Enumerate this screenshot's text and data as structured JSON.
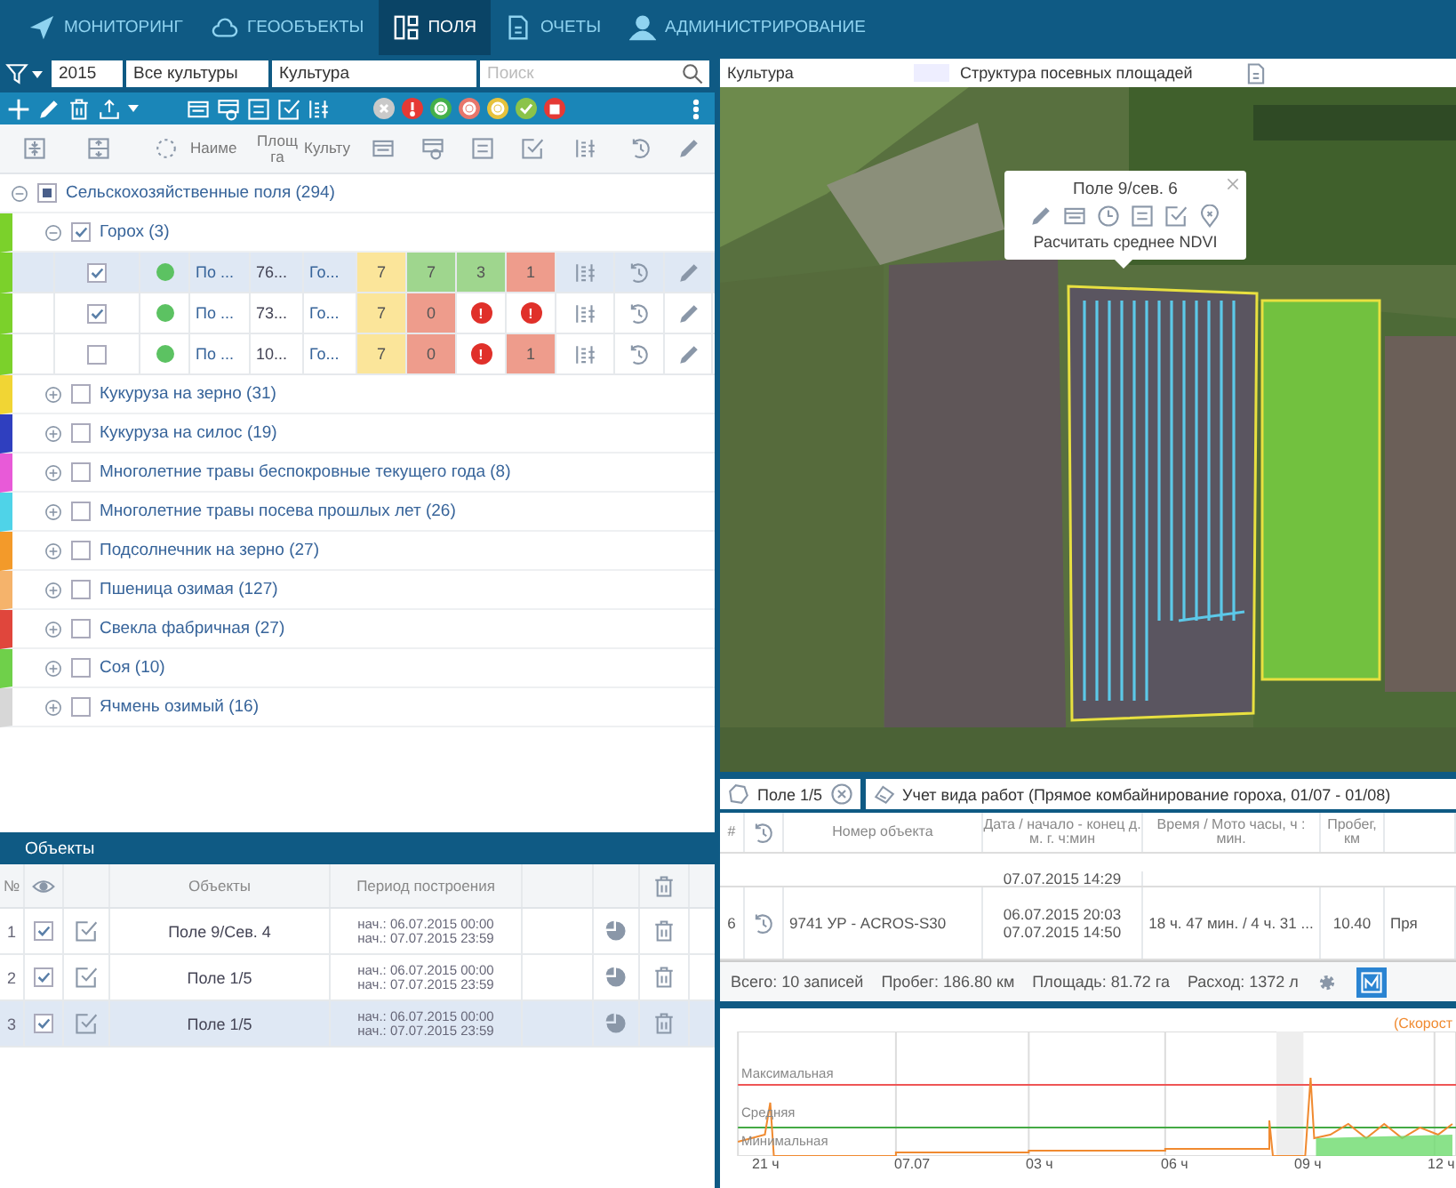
{
  "nav": {
    "items": [
      {
        "label": "МОНИТОРИНГ",
        "selected": false
      },
      {
        "label": "ГЕООБЪЕКТЫ",
        "selected": false
      },
      {
        "label": "ПОЛЯ",
        "selected": true
      },
      {
        "label": "ОЧЕТЫ",
        "selected": false
      },
      {
        "label": "АДМИНИСТРИРОВАНИЕ",
        "selected": false
      }
    ]
  },
  "filters": {
    "year": "2015",
    "crops": "Все культуры",
    "group_by": "Культура",
    "search_placeholder": "Поиск"
  },
  "status_filters": [
    {
      "kind": "cross",
      "color": "#c9c9c9"
    },
    {
      "kind": "alert",
      "color": "#e53935"
    },
    {
      "kind": "eye",
      "color": "#45b04a"
    },
    {
      "kind": "eye",
      "color": "#e8766b"
    },
    {
      "kind": "eye",
      "color": "#e6c23c"
    },
    {
      "kind": "check",
      "color": "#8bc34a"
    },
    {
      "kind": "stop",
      "color": "#e53935"
    }
  ],
  "columns": {
    "name": "Наиме",
    "area": "Площ га",
    "crop": "Культу"
  },
  "tree": {
    "label": "Сельскохозяйственные поля (294)",
    "expanded": true,
    "partial": true,
    "children": [
      {
        "label": "Горох (3)",
        "color": "#7bd12b",
        "expanded": true,
        "checked": true,
        "fields": [
          {
            "selected": true,
            "checked": true,
            "color": "#5cc262",
            "name": "По ...",
            "area": "76...",
            "crop": "Го...",
            "cells": [
              {
                "kind": "value",
                "text": "7",
                "color": "#fbe59a"
              },
              {
                "kind": "value",
                "text": "7",
                "color": "#9fd68e"
              },
              {
                "kind": "value",
                "text": "3",
                "color": "#9fd68e"
              },
              {
                "kind": "value",
                "text": "1",
                "color": "#ee9c8c"
              }
            ]
          },
          {
            "selected": false,
            "checked": true,
            "color": "#5cc262",
            "name": "По ...",
            "area": "73...",
            "crop": "Го...",
            "cells": [
              {
                "kind": "value",
                "text": "7",
                "color": "#fbe59a"
              },
              {
                "kind": "value",
                "text": "0",
                "color": "#ee9c8c"
              },
              {
                "kind": "alert",
                "text": "!"
              },
              {
                "kind": "alert",
                "text": "!"
              }
            ]
          },
          {
            "selected": false,
            "checked": false,
            "color": "#5cc262",
            "name": "По ...",
            "area": "10...",
            "crop": "Го...",
            "cells": [
              {
                "kind": "value",
                "text": "7",
                "color": "#fbe59a"
              },
              {
                "kind": "value",
                "text": "0",
                "color": "#ee9c8c"
              },
              {
                "kind": "alert",
                "text": "!"
              },
              {
                "kind": "value",
                "text": "1",
                "color": "#ee9c8c"
              }
            ]
          }
        ]
      },
      {
        "label": "Кукуруза на зерно (31)",
        "color": "#f1d534",
        "expanded": false,
        "checked": false
      },
      {
        "label": "Кукуруза на силос (19)",
        "color": "#2f3fbf",
        "expanded": false,
        "checked": false
      },
      {
        "label": "Многолетние травы беспокровные текущего года (8)",
        "color": "#e85ad8",
        "expanded": false,
        "checked": false
      },
      {
        "label": "Многолетние травы посева прошлых лет (26)",
        "color": "#4fd3e8",
        "expanded": false,
        "checked": false
      },
      {
        "label": "Подсолнечник на зерно (27)",
        "color": "#f39a2a",
        "expanded": false,
        "checked": false
      },
      {
        "label": "Пшеница озимая (127)",
        "color": "#f5b36b",
        "expanded": false,
        "checked": false
      },
      {
        "label": "Свекла фабричная (27)",
        "color": "#e0463c",
        "expanded": false,
        "checked": false
      },
      {
        "label": "Соя (10)",
        "color": "#6fd04a",
        "expanded": false,
        "checked": false
      },
      {
        "label": "Ячмень озимый (16)",
        "color": "#d7d7d7",
        "expanded": false,
        "checked": false
      }
    ]
  },
  "objects": {
    "title": "Объекты",
    "columns": {
      "number": "№",
      "name": "Объекты",
      "period": "Период построения"
    },
    "rows": [
      {
        "number": "1",
        "visible": true,
        "name": "Поле 9/Сев. 4",
        "from": "нач.: 06.07.2015 00:00",
        "to": "нач.: 07.07.2015 23:59",
        "selected": false
      },
      {
        "number": "2",
        "visible": true,
        "name": "Поле 1/5",
        "from": "нач.: 06.07.2015 00:00",
        "to": "нач.: 07.07.2015 23:59",
        "selected": false
      },
      {
        "number": "3",
        "visible": true,
        "name": "Поле 1/5",
        "from": "нач.: 06.07.2015 00:00",
        "to": "нач.: 07.07.2015 23:59",
        "selected": true
      }
    ]
  },
  "map": {
    "tabs": [
      "Культура",
      "Структура посевных площадей"
    ],
    "popup": {
      "title": "Поле 9/сев. 6",
      "action": "Расчитать среднее NDVI"
    }
  },
  "work": {
    "object_tab": "Поле 1/5",
    "report_tab": "Учет вида работ (Прямое комбайнирование гороха, 01/07 - 01/08)",
    "columns": {
      "number": "#",
      "object": "Номер объекта",
      "date": "Дата / начало - конец д. м. г. ч:мин",
      "time": "Время / Мото часы, ч : мин.",
      "distance": "Пробег, км"
    },
    "rows": [
      {
        "date_end": "07.07.2015 14:29"
      },
      {
        "number": "6",
        "object": "9741 УР - ACROS-S30",
        "date_start": "06.07.2015 20:03",
        "date_end": "07.07.2015 14:50",
        "time": "18 ч. 47 мин. / 4 ч. 31 ...",
        "distance": "10.40",
        "column_6": "Пря"
      }
    ],
    "summary": [
      "Всего: 10 записей",
      "Пробег: 186.80 км",
      "Площадь: 81.72 га",
      "Расход: 1372 л"
    ],
    "chart_view_selected": true
  },
  "speed_chart": {
    "legend": "(Скорост",
    "levels": [
      "Максимальная",
      "Средняя",
      "Минимальная"
    ],
    "time_labels": [
      "21 ч",
      "07.07",
      "03 ч",
      "06 ч",
      "09 ч",
      "12 ч"
    ]
  }
}
